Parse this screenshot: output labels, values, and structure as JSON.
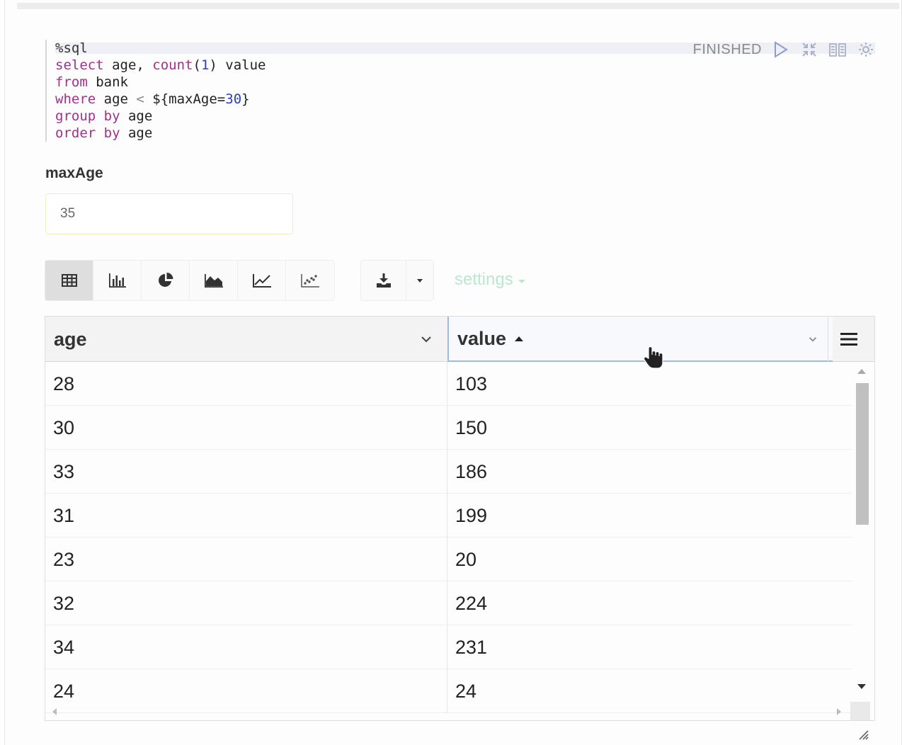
{
  "editor": {
    "lines": [
      [
        {
          "t": "%sql",
          "c": "cmt"
        }
      ],
      [
        {
          "t": "select",
          "c": "kw"
        },
        {
          "t": " age, ",
          "c": ""
        },
        {
          "t": "count",
          "c": "kw"
        },
        {
          "t": "(",
          "c": ""
        },
        {
          "t": "1",
          "c": "num"
        },
        {
          "t": ") value",
          "c": ""
        }
      ],
      [
        {
          "t": "from",
          "c": "kw"
        },
        {
          "t": " bank",
          "c": ""
        }
      ],
      [
        {
          "t": "where",
          "c": "kw"
        },
        {
          "t": " age ",
          "c": ""
        },
        {
          "t": "<",
          "c": "op"
        },
        {
          "t": " ${maxAge=",
          "c": ""
        },
        {
          "t": "30",
          "c": "num"
        },
        {
          "t": "}",
          "c": ""
        }
      ],
      [
        {
          "t": "group",
          "c": "kw"
        },
        {
          "t": " ",
          "c": ""
        },
        {
          "t": "by",
          "c": "kw"
        },
        {
          "t": " age",
          "c": ""
        }
      ],
      [
        {
          "t": "order",
          "c": "kw"
        },
        {
          "t": " ",
          "c": ""
        },
        {
          "t": "by",
          "c": "kw"
        },
        {
          "t": " age",
          "c": ""
        }
      ]
    ]
  },
  "paragraph": {
    "status": "FINISHED",
    "icons": [
      "run-icon",
      "collapse-icon",
      "book-icon",
      "gear-icon"
    ]
  },
  "form": {
    "label": "maxAge",
    "value": "35"
  },
  "toolbar": {
    "viz_buttons": [
      "table-icon",
      "bar-chart-icon",
      "pie-chart-icon",
      "area-chart-icon",
      "line-chart-icon",
      "scatter-chart-icon"
    ],
    "active": "table-icon",
    "settings_label": "settings"
  },
  "grid": {
    "columns": [
      {
        "label": "age",
        "sort": ""
      },
      {
        "label": "value",
        "sort": "asc"
      }
    ],
    "rows": [
      [
        "28",
        "103"
      ],
      [
        "30",
        "150"
      ],
      [
        "33",
        "186"
      ],
      [
        "31",
        "199"
      ],
      [
        "23",
        "20"
      ],
      [
        "32",
        "224"
      ],
      [
        "34",
        "231"
      ],
      [
        "24",
        "24"
      ]
    ]
  },
  "colors": {
    "keyword": "#a2308a",
    "number": "#2a3dc4",
    "settings": "#b9e7cf",
    "sort_header_border": "#9fbadf"
  }
}
